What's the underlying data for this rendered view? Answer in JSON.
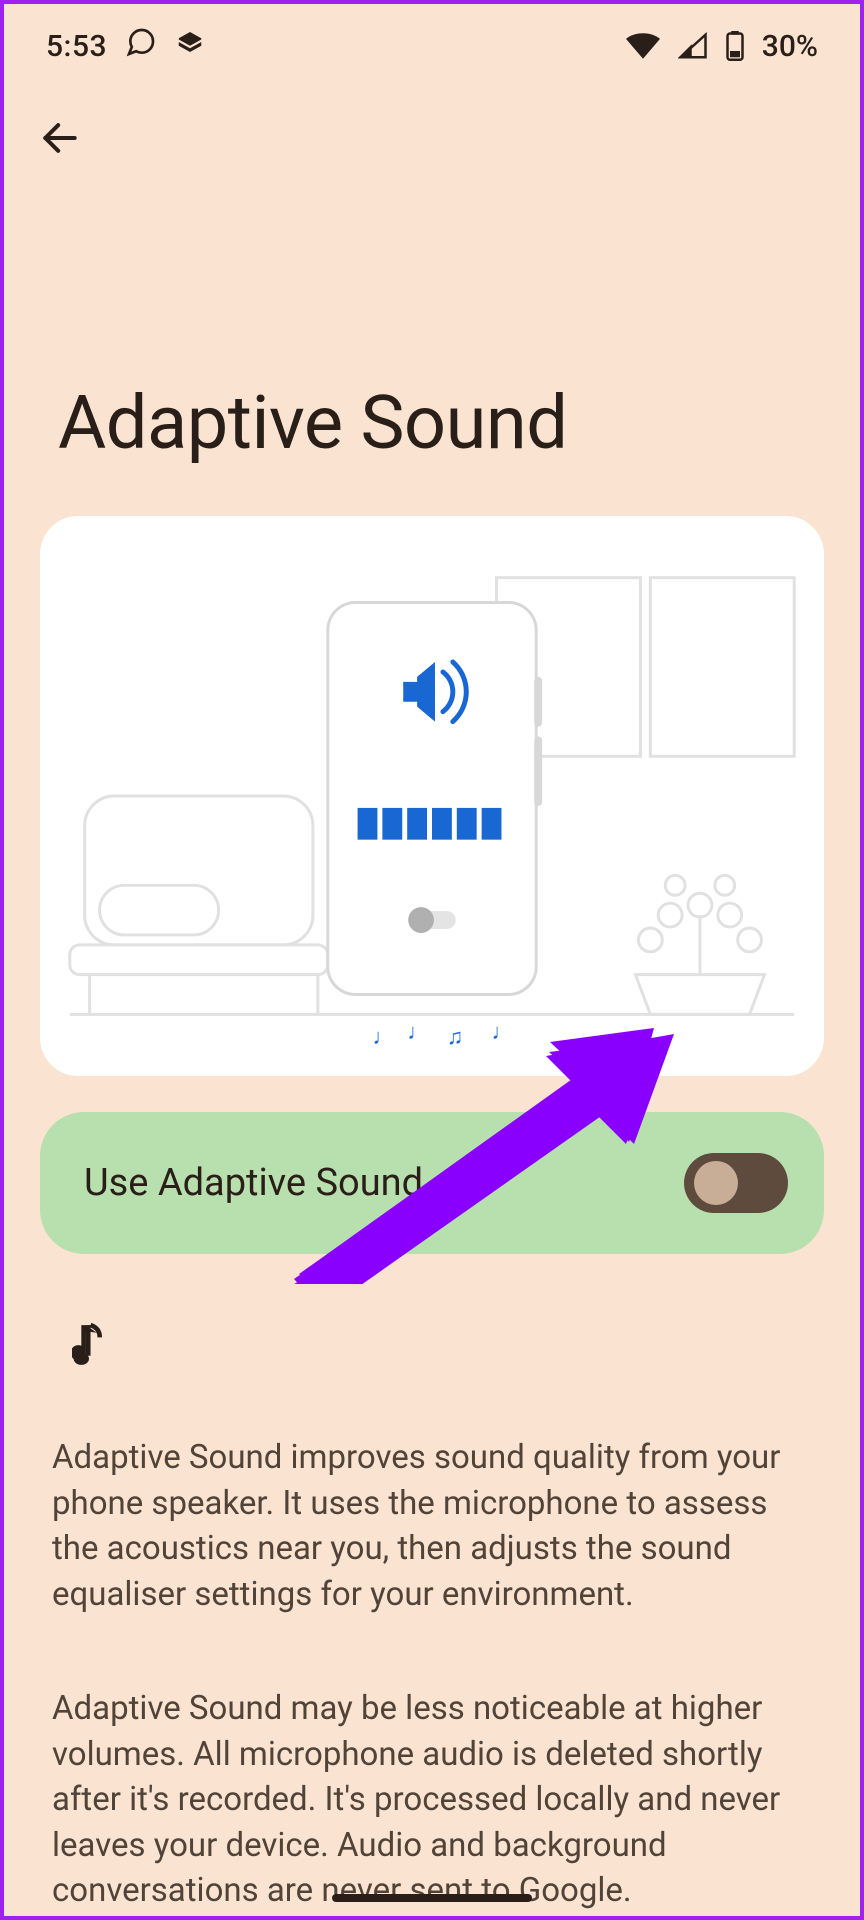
{
  "statusbar": {
    "time": "5:53",
    "battery_text": "30%"
  },
  "page": {
    "title": "Adaptive Sound"
  },
  "toggle": {
    "label": "Use Adaptive Sound",
    "state": "off"
  },
  "description": {
    "paragraph1": "Adaptive Sound improves sound quality from your phone speaker. It uses the microphone to assess the acoustics near you, then adjusts the sound equaliser settings for your environment.",
    "paragraph2": "Adaptive Sound may be less noticeable at higher volumes. All microphone audio is deleted shortly after it's recorded. It's processed locally and never leaves your device. Audio and background conversations are never sent to Google."
  }
}
